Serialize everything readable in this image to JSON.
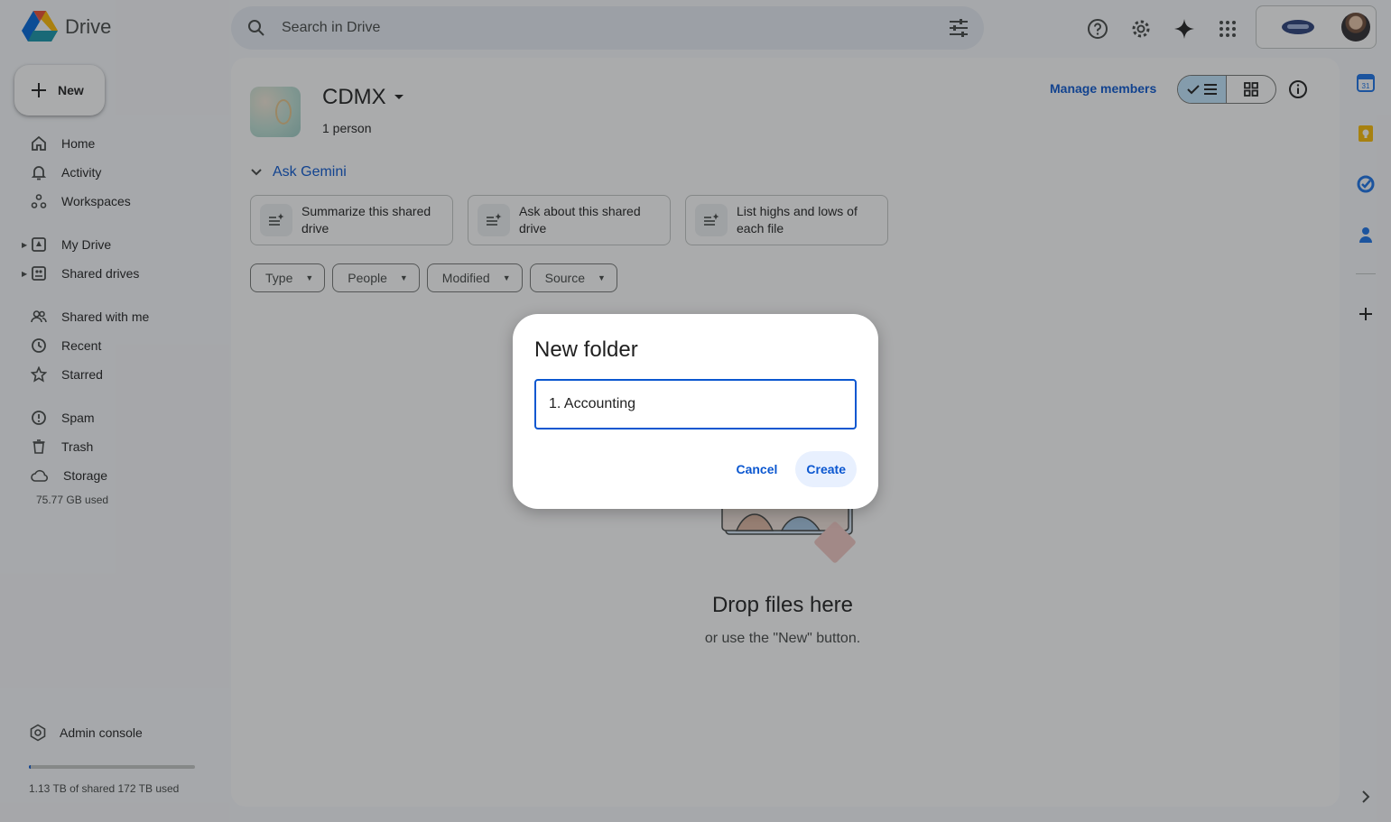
{
  "app": {
    "name": "Drive"
  },
  "search": {
    "placeholder": "Search in Drive"
  },
  "sidebar": {
    "new_label": "New",
    "items": [
      {
        "label": "Home",
        "icon": "home-icon"
      },
      {
        "label": "Activity",
        "icon": "bell-icon"
      },
      {
        "label": "Workspaces",
        "icon": "workspaces-icon"
      },
      {
        "label": "My Drive",
        "icon": "my-drive-icon"
      },
      {
        "label": "Shared drives",
        "icon": "shared-drives-icon"
      },
      {
        "label": "Shared with me",
        "icon": "people-icon"
      },
      {
        "label": "Recent",
        "icon": "clock-icon"
      },
      {
        "label": "Starred",
        "icon": "star-icon"
      },
      {
        "label": "Spam",
        "icon": "spam-icon"
      },
      {
        "label": "Trash",
        "icon": "trash-icon"
      },
      {
        "label": "Storage",
        "icon": "cloud-icon"
      }
    ],
    "storage_used": "75.77 GB used",
    "admin_console": "Admin console",
    "quota_text": "1.13 TB of shared 172 TB used",
    "quota_fraction": 0.0066
  },
  "drive": {
    "name": "CDMX",
    "members": "1 person",
    "manage_members": "Manage members"
  },
  "gemini": {
    "label": "Ask Gemini",
    "chips": [
      "Summarize this shared drive",
      "Ask about this shared drive",
      "List highs and lows of each file"
    ]
  },
  "filters": [
    "Type",
    "People",
    "Modified",
    "Source"
  ],
  "empty_state": {
    "title": "Drop files here",
    "subtitle": "or use the \"New\" button."
  },
  "dialog": {
    "title": "New folder",
    "input_value": "1. Accounting",
    "cancel": "Cancel",
    "create": "Create"
  },
  "colors": {
    "accent": "#0b57d0",
    "toggle_selected": "#c2e7ff",
    "calendar": "#1a73e8",
    "keep": "#fbbc04",
    "tasks": "#1a73e8",
    "contacts": "#1a73e8"
  }
}
